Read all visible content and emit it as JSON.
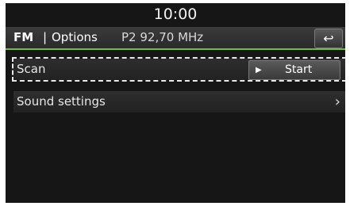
{
  "clock": "10:00",
  "header": {
    "source": "FM",
    "separator": "|",
    "title": "Options",
    "preset": "P2  92,70 MHz",
    "back_icon": "↩"
  },
  "menu": {
    "scan": {
      "label": "Scan",
      "button_icon": "▶",
      "button_label": "Start"
    },
    "sound": {
      "label": "Sound settings",
      "chevron": "›"
    }
  },
  "colors": {
    "accent": "#6fbf2f",
    "background": "#161616"
  }
}
